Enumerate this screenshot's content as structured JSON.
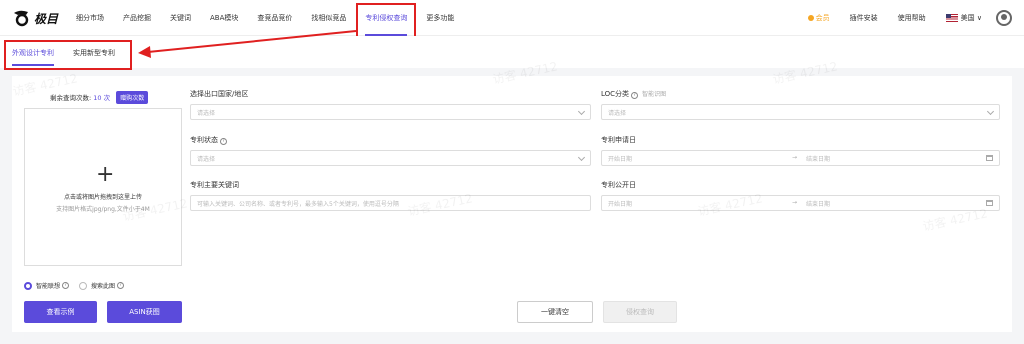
{
  "brand": {
    "logo_text": "极目"
  },
  "nav": {
    "items": [
      {
        "label": "细分市场"
      },
      {
        "label": "产品挖掘"
      },
      {
        "label": "关键词"
      },
      {
        "label": "ABA模块"
      },
      {
        "label": "查竞品竞价"
      },
      {
        "label": "找相似竞品"
      },
      {
        "label": "专利侵权查询"
      },
      {
        "label": "更多功能"
      }
    ],
    "active_index": 6
  },
  "right_nav": {
    "member": "会员",
    "plugin": "插件安装",
    "help": "使用帮助",
    "region": "美国"
  },
  "subtabs": [
    {
      "label": "外观设计专利"
    },
    {
      "label": "实用新型专利"
    }
  ],
  "left": {
    "quota_label": "剩余查询次数:",
    "quota_value": "10 次",
    "buy_label": "赠购次数",
    "upload_text": "点击或将图片拖拽到这里上传",
    "upload_hint": "支持图片格式jpg/png,文件小于4M",
    "radio_smart": "智能联想",
    "radio_search": "搜索此图",
    "btn_example": "查看示例",
    "btn_asin": "ASIN获图"
  },
  "form": {
    "country_label": "选择出口国家/地区",
    "country_placeholder": "请选择",
    "loc_label": "LOC分类",
    "loc_hint": "智能识图",
    "loc_placeholder": "请选择",
    "status_label": "专利状态",
    "status_placeholder": "请选择",
    "apply_date_label": "专利申请日",
    "start_placeholder": "开始日期",
    "end_placeholder": "结束日期",
    "keyword_label": "专利主要关键词",
    "keyword_placeholder": "可输入关键词、公司名称、或者专利号，最多输入5个关键词，使用逗号分隔",
    "publish_date_label": "专利公开日",
    "btn_clear": "一键清空",
    "btn_query": "侵权查询"
  },
  "watermark": "访客 42712",
  "colors": {
    "accent": "#5b4bdb",
    "highlight": "#e02020",
    "member": "#f5a623"
  }
}
